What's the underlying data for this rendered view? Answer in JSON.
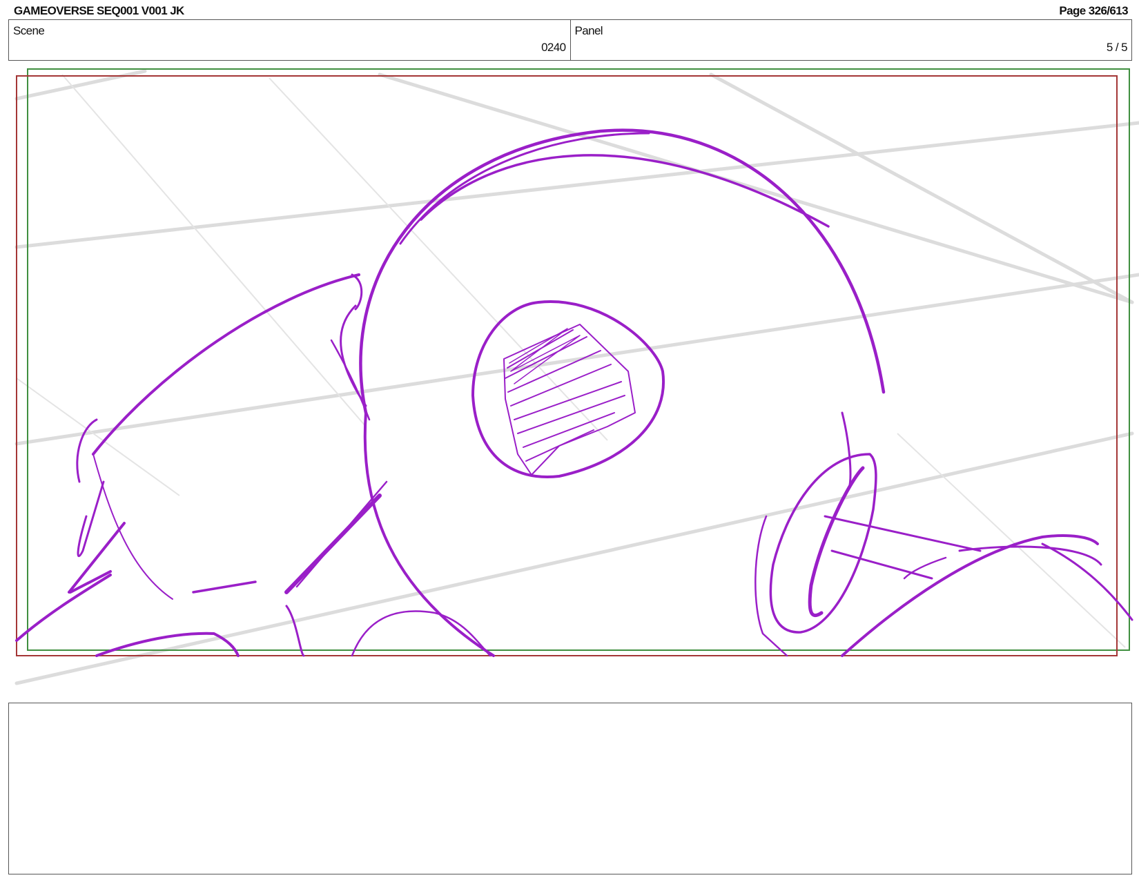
{
  "header": {
    "title": "GAMEOVERSE SEQ001 V001 JK",
    "page": "Page 326/613"
  },
  "info": {
    "scene_label": "Scene",
    "scene_value": "0240",
    "panel_label": "Panel",
    "panel_value": "5 / 5"
  },
  "colors": {
    "sketch": "#9a1fc8",
    "safe_frame": "#a43636",
    "camera_frame": "#3f8f3f",
    "grid": "#dadada"
  },
  "notes": {
    "text": ""
  }
}
